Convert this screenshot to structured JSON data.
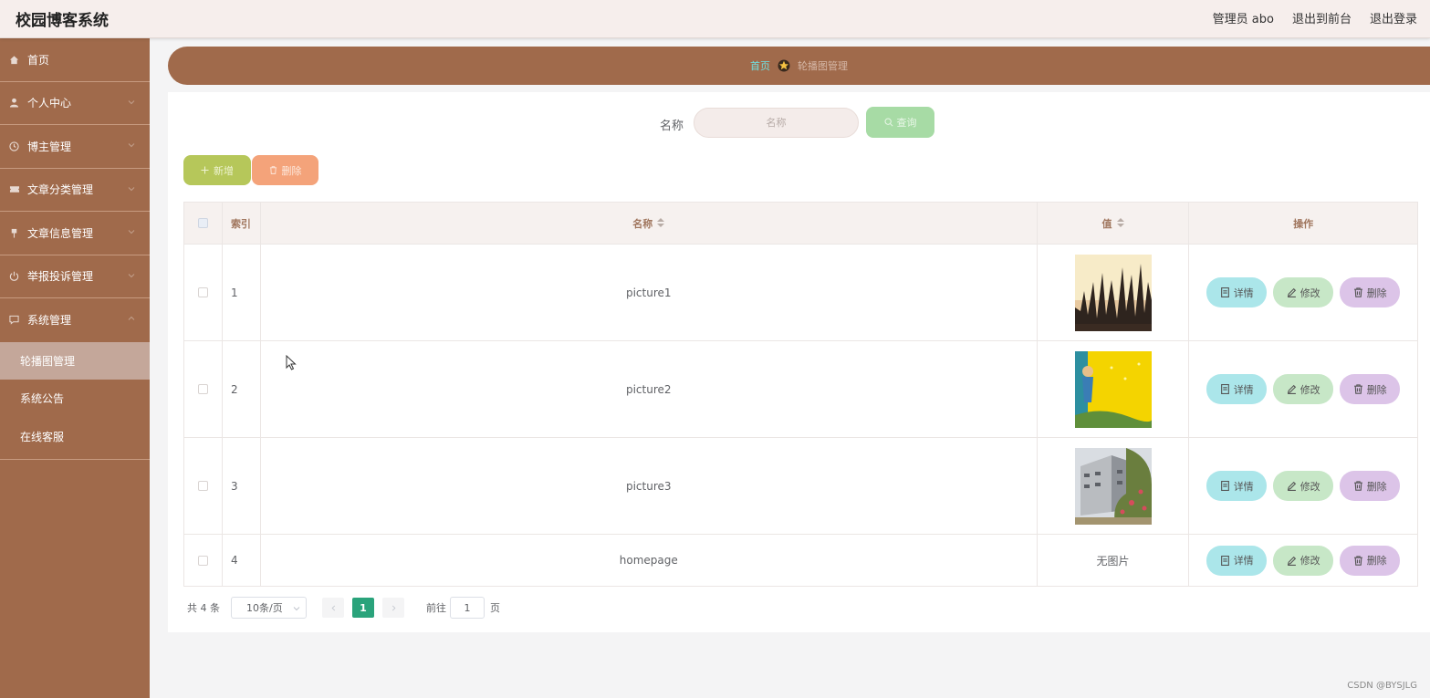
{
  "header": {
    "title": "校园博客系统",
    "admin": "管理员 abo",
    "to_front": "退出到前台",
    "logout": "退出登录"
  },
  "sidebar": {
    "items": [
      {
        "label": "首页",
        "icon": "home-icon"
      },
      {
        "label": "个人中心",
        "icon": "user-icon"
      },
      {
        "label": "博主管理",
        "icon": "clock-icon"
      },
      {
        "label": "文章分类管理",
        "icon": "ticket-icon"
      },
      {
        "label": "文章信息管理",
        "icon": "pin-icon"
      },
      {
        "label": "举报投诉管理",
        "icon": "power-icon"
      },
      {
        "label": "系统管理",
        "icon": "chat-icon"
      }
    ],
    "sub_items": [
      {
        "label": "轮播图管理",
        "active": true
      },
      {
        "label": "系统公告",
        "active": false
      },
      {
        "label": "在线客服",
        "active": false
      }
    ]
  },
  "breadcrumb": {
    "home": "首页",
    "current": "轮播图管理"
  },
  "search": {
    "label": "名称",
    "placeholder": "名称",
    "button": "查询"
  },
  "actions": {
    "add": "新增",
    "delete": "删除"
  },
  "table": {
    "headers": {
      "index": "索引",
      "name": "名称",
      "value": "值",
      "ops": "操作"
    },
    "rows": [
      {
        "index": "1",
        "name": "picture1",
        "value": "image-dry-grass"
      },
      {
        "index": "2",
        "name": "picture2",
        "value": "image-yellow-cartoon"
      },
      {
        "index": "3",
        "name": "picture3",
        "value": "image-campus-building"
      },
      {
        "index": "4",
        "name": "homepage",
        "value": "无图片"
      }
    ],
    "ops": {
      "detail": "详情",
      "edit": "修改",
      "delete": "删除"
    }
  },
  "pagination": {
    "total": "共 4 条",
    "page_size": "10条/页",
    "current": "1",
    "goto": "前往",
    "goto_value": "1",
    "page_suffix": "页"
  },
  "watermark": "CSDN @BYSJLG",
  "colors": {
    "sidebar": "#a06a4b",
    "header": "#f6eeec",
    "accent_page": "#2aa37b"
  }
}
